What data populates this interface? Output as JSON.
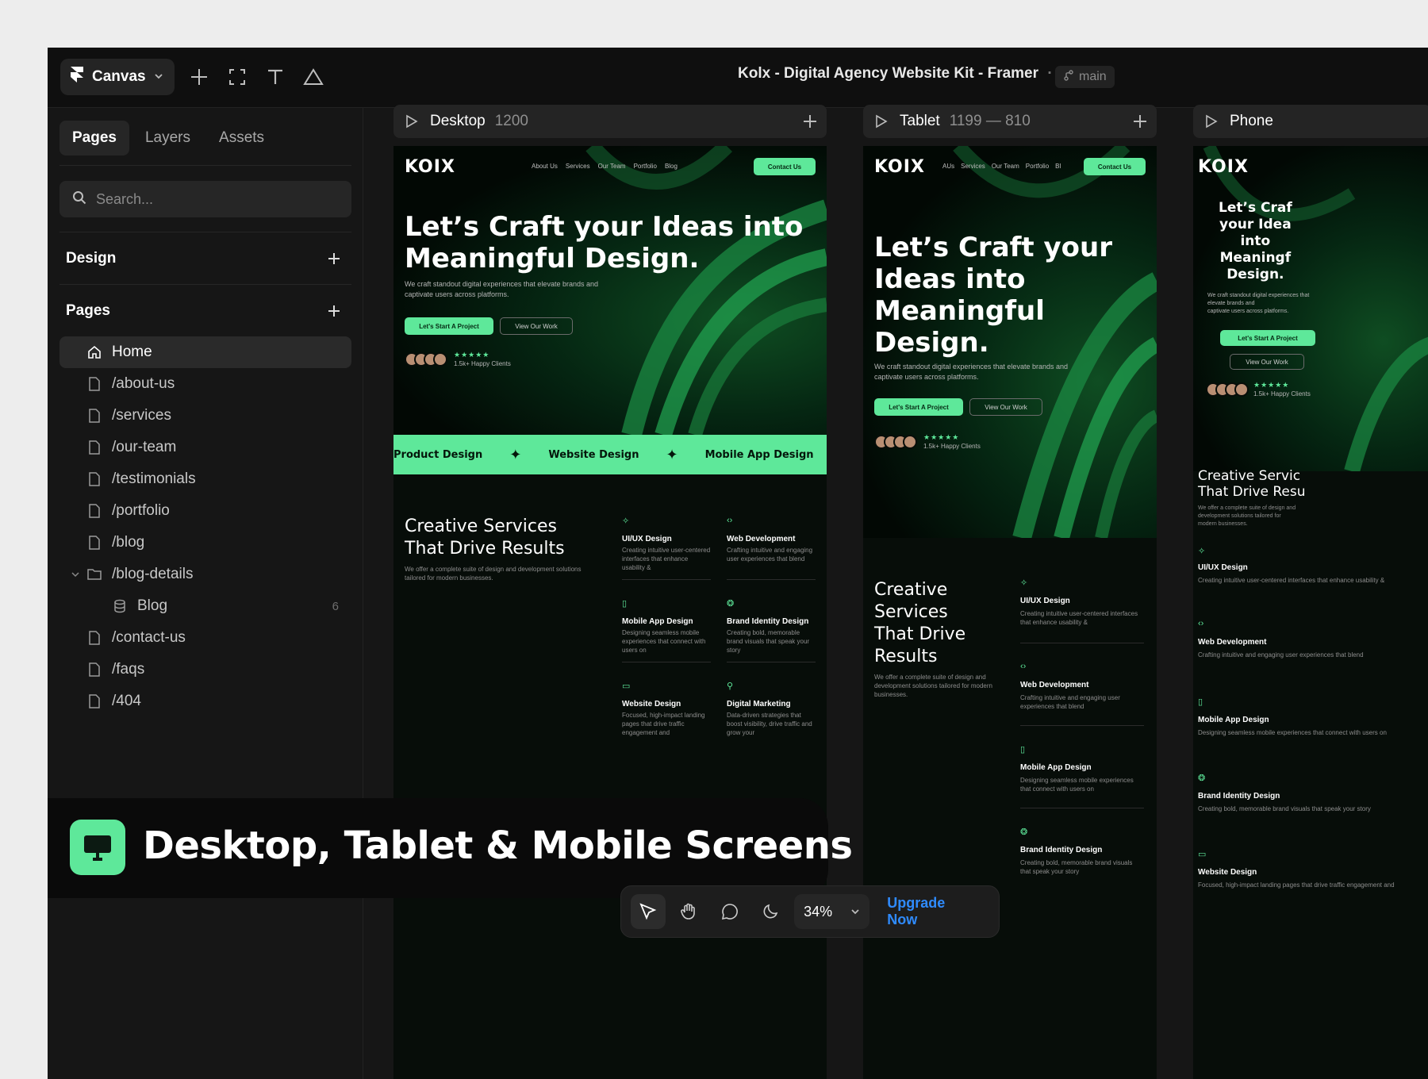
{
  "topbar": {
    "canvas_label": "Canvas",
    "doc_title": "Kolx - Digital Agency Website Kit - Framer",
    "separator": "·",
    "branch": "main"
  },
  "sidebar": {
    "tabs": [
      "Pages",
      "Layers",
      "Assets"
    ],
    "search_placeholder": "Search...",
    "design_label": "Design",
    "pages_label": "Pages",
    "pages": [
      {
        "label": "Home",
        "icon": "home-icon"
      },
      {
        "label": "/about-us",
        "icon": "page-icon"
      },
      {
        "label": "/services",
        "icon": "page-icon"
      },
      {
        "label": "/our-team",
        "icon": "page-icon"
      },
      {
        "label": "/testimonials",
        "icon": "page-icon"
      },
      {
        "label": "/portfolio",
        "icon": "page-icon"
      },
      {
        "label": "/blog",
        "icon": "page-icon"
      },
      {
        "label": "/blog-details",
        "icon": "folder-icon"
      },
      {
        "label": "Blog",
        "icon": "database-icon",
        "count": "6"
      },
      {
        "label": "/contact-us",
        "icon": "page-icon"
      },
      {
        "label": "/faqs",
        "icon": "page-icon"
      },
      {
        "label": "/404",
        "icon": "page-icon"
      }
    ]
  },
  "breakpoints": {
    "desktop": {
      "name": "Desktop",
      "size": "1200"
    },
    "tablet": {
      "name": "Tablet",
      "size": "1199 — 810"
    },
    "phone": {
      "name": "Phone"
    }
  },
  "site": {
    "logo": "KOIX",
    "nav": [
      "About Us",
      "Services",
      "Our Team",
      "Portfolio",
      "Blog"
    ],
    "nav_tablet": [
      "AUs",
      "Services",
      "Our Team",
      "Portfolio",
      "Bl"
    ],
    "contact_btn": "Contact Us",
    "headline_desktop_1": "Let’s Craft your Ideas into",
    "headline_desktop_2": "Meaningful Design.",
    "headline_tablet": [
      "Let’s Craft your",
      "Ideas into",
      "Meaningful",
      "Design."
    ],
    "headline_phone": [
      "Let’s Craf",
      "your Idea",
      "into",
      "Meaningf",
      "Design."
    ],
    "subtext_1": "We craft standout digital experiences that elevate brands and",
    "subtext_2": "captivate users across platforms.",
    "start_btn": "Let's Start A Project",
    "view_btn": "View Our Work",
    "stars": "★★★★★",
    "clients": "1.5k+ Happy Clients",
    "ticker": [
      "Product Design",
      "Website Design",
      "Mobile App Design"
    ],
    "services_title_1": "Creative Services",
    "services_title_2": "That Drive Results",
    "services_title_tablet": [
      "Creative",
      "Services",
      "That Drive",
      "Results"
    ],
    "services_title_phone": [
      "Creative Servic",
      "That Drive Resu"
    ],
    "services_sub": "We offer a complete suite of design and development solutions tailored for modern businesses.",
    "services": [
      {
        "name": "UI/UX Design",
        "desc": "Creating intuitive user-centered interfaces that enhance usability &"
      },
      {
        "name": "Web Development",
        "desc": "Crafting intuitive and engaging user experiences that blend"
      },
      {
        "name": "Mobile App Design",
        "desc": "Designing seamless mobile experiences that connect with users on"
      },
      {
        "name": "Brand Identity Design",
        "desc": "Creating bold, memorable brand visuals that speak your story"
      },
      {
        "name": "Website Design",
        "desc": "Focused, high-impact landing pages that drive traffic engagement and"
      },
      {
        "name": "Digital Marketing",
        "desc": "Data-driven strategies that boost visibility, drive traffic and grow your"
      }
    ]
  },
  "banner": {
    "text": "Desktop, Tablet & Mobile Screens",
    "icon": "monitor-icon"
  },
  "toolbar": {
    "zoom": "34%",
    "upgrade": "Upgrade Now"
  },
  "colors": {
    "accent": "#5ee89a",
    "upgrade": "#2f8bff",
    "panel": "#161616"
  }
}
